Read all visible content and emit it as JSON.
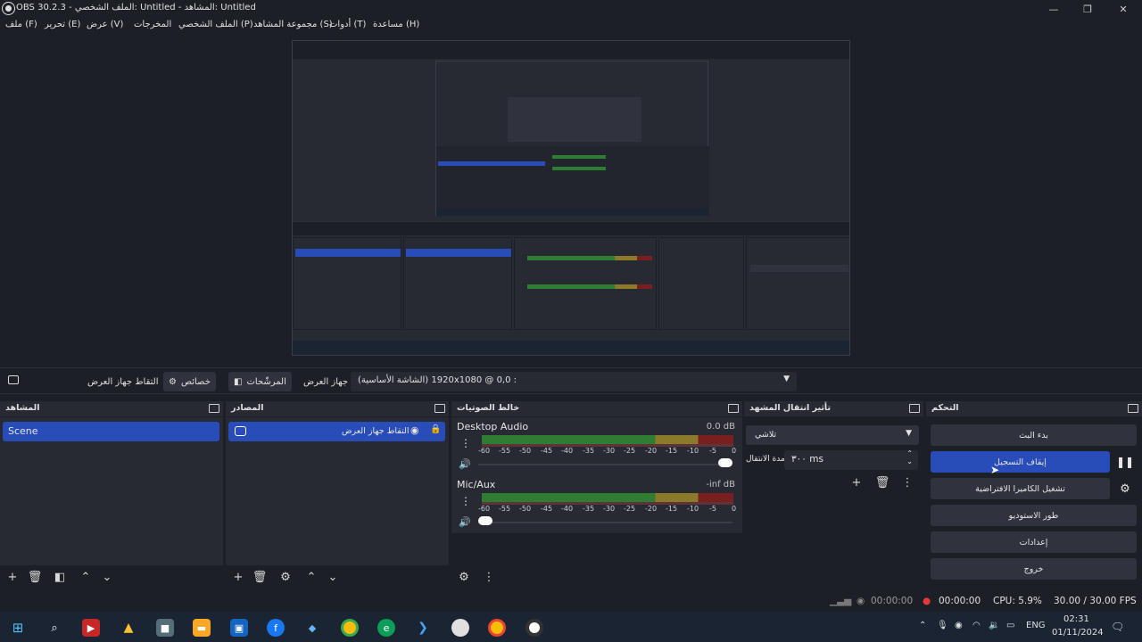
{
  "window": {
    "title": "OBS 30.2.3 - الملف الشخصي: Untitled - المشاهد: Untitled",
    "minimize": "—",
    "maximize": "❐",
    "close": "✕"
  },
  "menu": [
    {
      "label": "ملف (F)"
    },
    {
      "label": "تحرير (E)"
    },
    {
      "label": "عرض (V)"
    },
    {
      "label": "المخرجات"
    },
    {
      "label": "الملف الشخصي (P)"
    },
    {
      "label": "مجموعة المشاهد (S)"
    },
    {
      "label": "أدوات (T)"
    },
    {
      "label": "مساعدة (H)"
    }
  ],
  "source_toolbar": {
    "display_label": "التقاط جهاز العرض",
    "properties_label": "خصائص",
    "filters_label": "المرشّحات",
    "display_device_label": "جهاز العرض",
    "display_select_value": "(الشاشة الأساسية) 1920x1080 @ 0,0 :"
  },
  "scenes": {
    "title": "المشاهد",
    "items": [
      "Scene"
    ]
  },
  "sources": {
    "title": "المصادر",
    "items": [
      "التقاط جهاز العرض"
    ]
  },
  "mixer": {
    "title": "خالط الصوتيات",
    "ticks": [
      "-60",
      "-55",
      "-50",
      "-45",
      "-40",
      "-35",
      "-30",
      "-25",
      "-20",
      "-15",
      "-10",
      "-5",
      "0"
    ],
    "channels": [
      {
        "name": "Desktop Audio",
        "level": "0.0 dB",
        "volume": 1.0
      },
      {
        "name": "Mic/Aux",
        "level": "-inf dB",
        "volume": 0.0
      }
    ]
  },
  "transitions": {
    "title": "تأثير انتقال المشهد",
    "type": "تلاشي",
    "duration_label": "مدة الانتقال",
    "duration_value": "٣٠٠ ms"
  },
  "controls": {
    "title": "التحكم",
    "start_stream": "بدء البث",
    "stop_recording": "إيقاف التسجيل",
    "virtual_camera": "تشغيل الكاميرا الافتراضية",
    "studio_mode": "طور الاستوديو",
    "settings": "إعدادات",
    "exit": "خروج"
  },
  "status": {
    "stream_time": "00:00:00",
    "rec_time": "00:00:00",
    "cpu": "CPU: 5.9%",
    "fps": "30.00 / 30.00 FPS"
  },
  "taskbar": {
    "language": "ENG",
    "time": "02:31",
    "date": "01/11/2024"
  },
  "colors": {
    "accent": "#284cb8",
    "background": "#1d1f26",
    "panel": "#272a33",
    "meter_green": "#2e7d32",
    "meter_yellow": "#8a7a2a",
    "meter_red": "#7a1f1f",
    "record_red": "#e53935"
  }
}
